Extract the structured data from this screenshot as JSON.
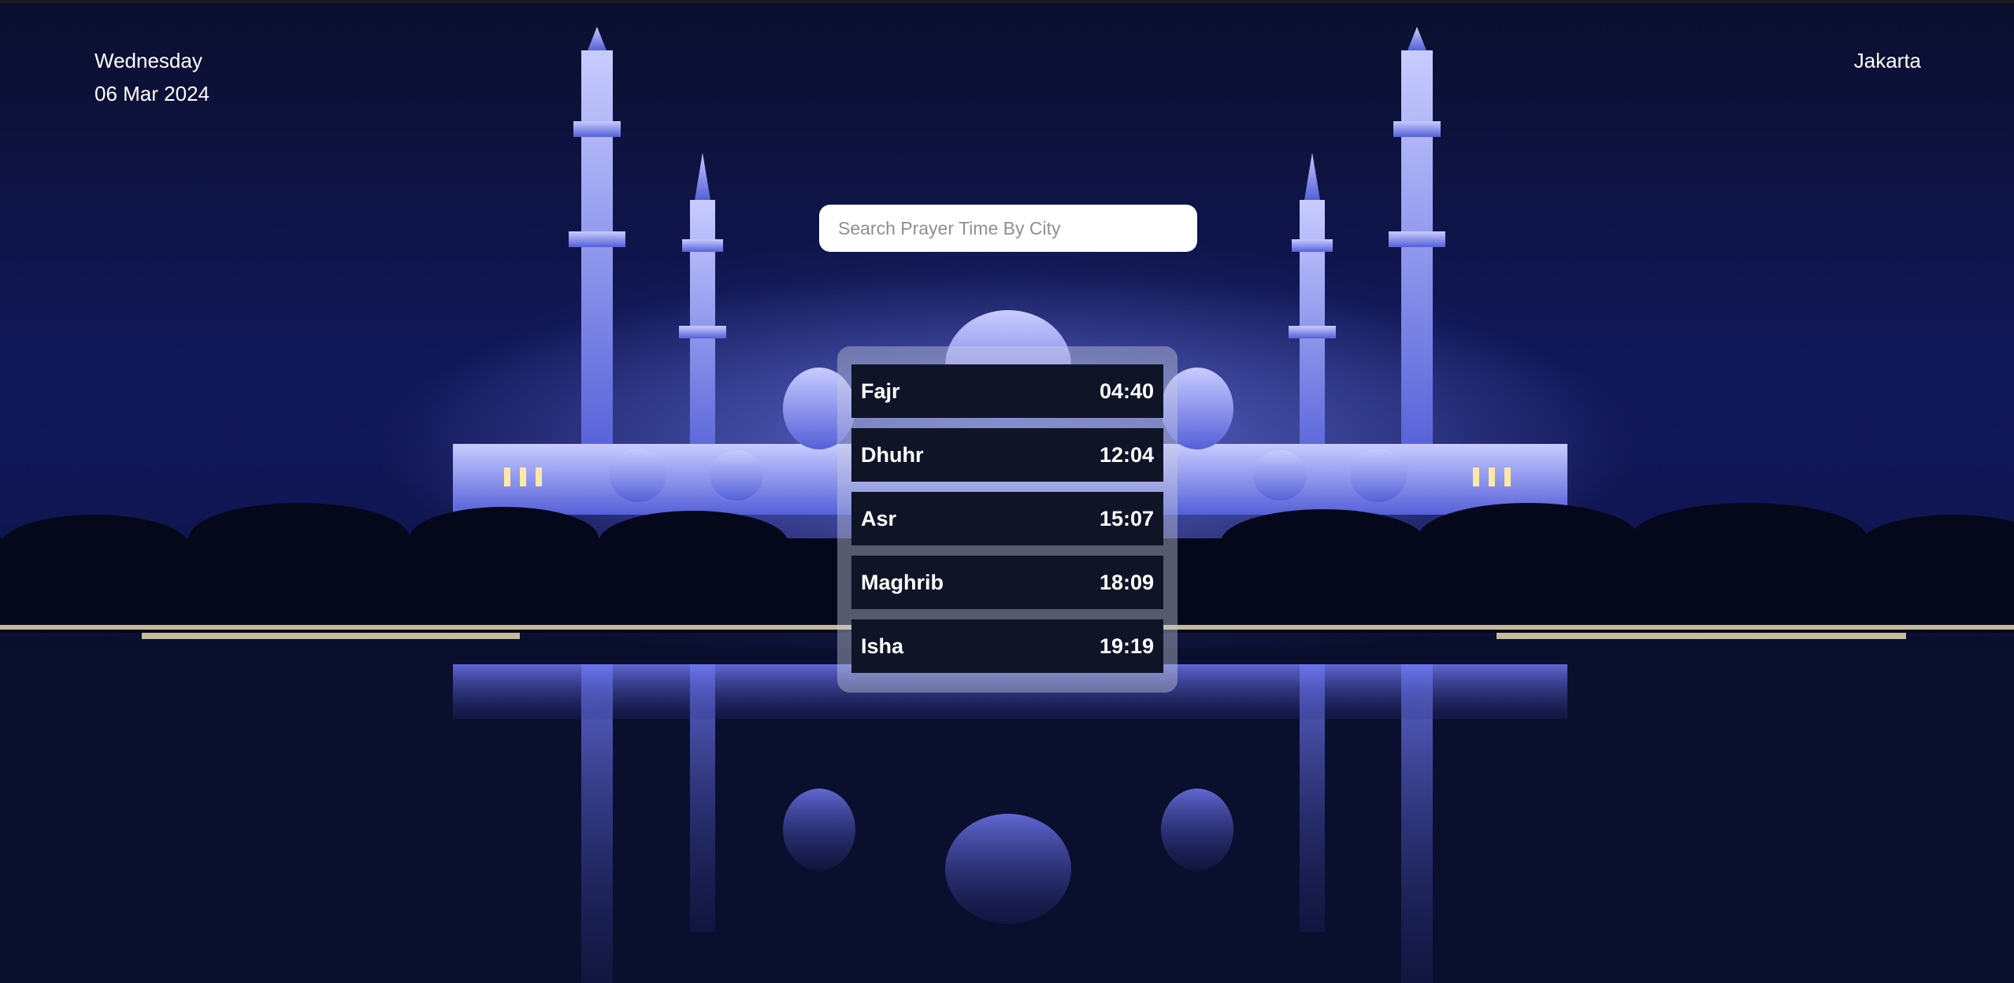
{
  "header": {
    "day": "Wednesday",
    "date": "06 Mar 2024",
    "city": "Jakarta"
  },
  "search": {
    "placeholder": "Search Prayer Time By City",
    "value": ""
  },
  "prayers": [
    {
      "name": "Fajr",
      "time": "04:40"
    },
    {
      "name": "Dhuhr",
      "time": "12:04"
    },
    {
      "name": "Asr",
      "time": "15:07"
    },
    {
      "name": "Maghrib",
      "time": "18:09"
    },
    {
      "name": "Isha",
      "time": "19:19"
    }
  ],
  "colors": {
    "row_bg": "#0f1526",
    "panel_bg": "#c8cde1",
    "text": "#ffffff",
    "sky": "#11185a"
  }
}
